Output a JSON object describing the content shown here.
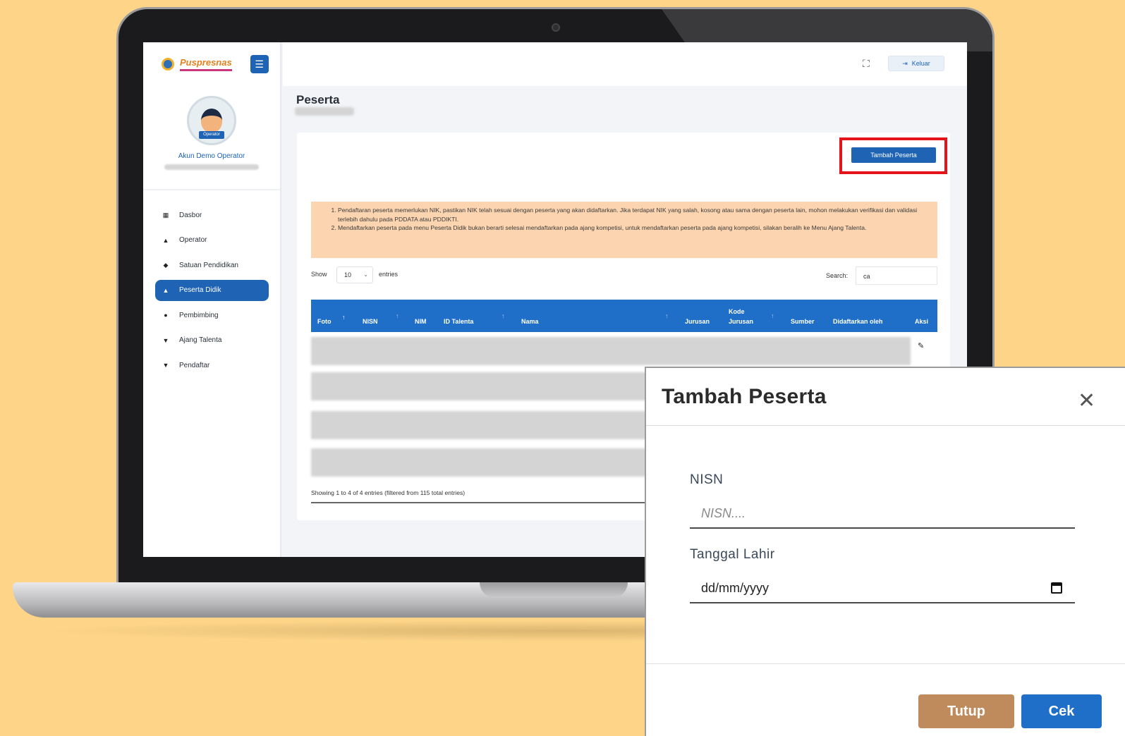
{
  "app": {
    "brand_name": "Puspresnas",
    "logout_label": "Keluar",
    "page_title": "Peserta"
  },
  "profile": {
    "name": "Akun Demo Operator",
    "badge": "Operator"
  },
  "sidebar": {
    "items": [
      {
        "label": "Dasbor",
        "icon": "dashboard-icon",
        "active": false
      },
      {
        "label": "Operator",
        "icon": "user-icon",
        "active": false
      },
      {
        "label": "Satuan Pendidikan",
        "icon": "graduation-cap-icon",
        "active": false
      },
      {
        "label": "Peserta Didik",
        "icon": "user-icon",
        "active": true
      },
      {
        "label": "Pembimbing",
        "icon": "users-icon",
        "active": false
      },
      {
        "label": "Ajang Talenta",
        "icon": "trophy-icon",
        "active": false
      },
      {
        "label": "Pendaftar",
        "icon": "trophy-icon",
        "active": false
      }
    ]
  },
  "main": {
    "add_button_label": "Tambah Peserta",
    "notice": [
      "Pendaftaran peserta memerlukan NIK, pastikan NIK telah sesuai dengan peserta yang akan didaftarkan. Jika terdapat NIK yang salah, kosong atau sama dengan peserta lain, mohon melakukan verifikasi dan validasi terlebih dahulu pada PDDATA atau PDDIKTI.",
      "Mendaftarkan peserta pada menu Peserta Didik bukan berarti selesai mendaftarkan pada ajang kompetisi, untuk mendaftarkan peserta pada ajang kompetisi, silakan beralih ke Menu Ajang Talenta."
    ],
    "show_label": "Show",
    "entries_value": "10",
    "entries_label": "entries",
    "search_label": "Search:",
    "search_value": "ca",
    "columns": {
      "foto": "Foto",
      "nisn": "NISN",
      "nim": "NIM",
      "id_talenta": "ID Talenta",
      "nama": "Nama",
      "jurusan": "Jurusan",
      "kode": "Kode",
      "kode_jurusan": "Jurusan",
      "sumber": "Sumber",
      "didaftarkan_oleh": "Didaftarkan oleh",
      "aksi": "Aksi"
    },
    "showing_text": "Showing 1 to 4 of 4 entries (filtered from 115 total entries)"
  },
  "modal": {
    "title": "Tambah Peserta",
    "nisn_label": "NISN",
    "nisn_placeholder": "NISN....",
    "dob_label": "Tanggal Lahir",
    "dob_placeholder": "dd/mm/yyyy",
    "close_button": "Tutup",
    "check_button": "Cek"
  }
}
